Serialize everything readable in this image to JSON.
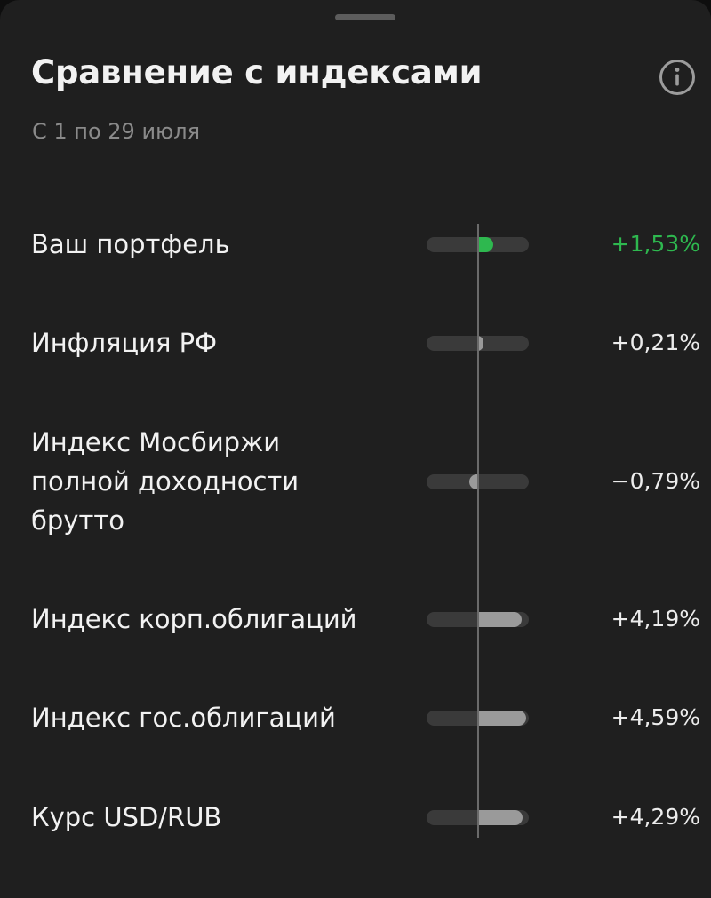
{
  "header": {
    "title": "Сравнение с индексами",
    "subtitle": "С 1 по 29 июля"
  },
  "colors": {
    "positive_accent": "#2eb84f",
    "bar_neutral": "#9a9a9a",
    "bar_track": "#3a3a3a",
    "text_primary": "#f2f2f2",
    "text_secondary": "#8a8a8a"
  },
  "icons": {
    "info": "info-circle-icon"
  },
  "rows": [
    {
      "label": "Ваш портфель",
      "value": "+1,53%",
      "percent": 1.53,
      "highlight": true
    },
    {
      "label": "Инфляция РФ",
      "value": "+0,21%",
      "percent": 0.21,
      "highlight": false
    },
    {
      "label": "Индекс Мосбиржи\nполной доходности\nбрутто",
      "value": "−0,79%",
      "percent": -0.79,
      "highlight": false
    },
    {
      "label": "Индекс корп.облигаций",
      "value": "+4,19%",
      "percent": 4.19,
      "highlight": false
    },
    {
      "label": "Индекс гос.облигаций",
      "value": "+4,59%",
      "percent": 4.59,
      "highlight": false
    },
    {
      "label": "Курс USD/RUB",
      "value": "+4,29%",
      "percent": 4.29,
      "highlight": false
    }
  ]
}
